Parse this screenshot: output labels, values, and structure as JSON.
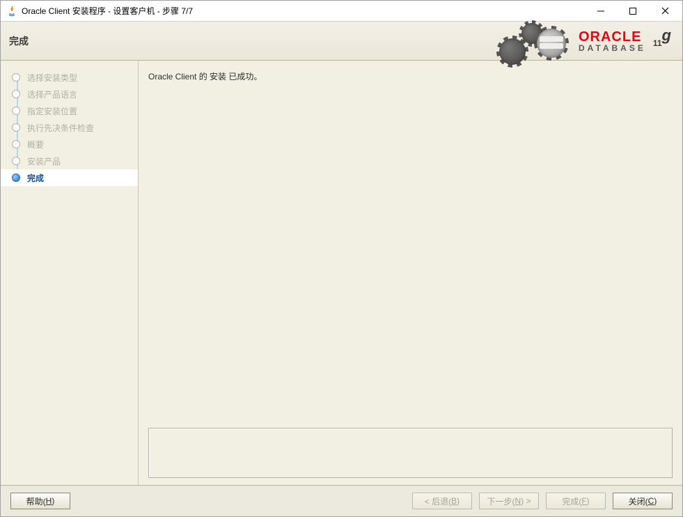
{
  "titlebar": {
    "title": "Oracle Client 安装程序 - 设置客户机 - 步骤 7/7"
  },
  "banner": {
    "page_title": "完成",
    "brand_main": "ORACLE",
    "brand_sub": "DATABASE",
    "version_main": "11",
    "version_suffix": "g"
  },
  "sidebar": {
    "steps": [
      {
        "label": "选择安装类型",
        "active": false
      },
      {
        "label": "选择产品语言",
        "active": false
      },
      {
        "label": "指定安装位置",
        "active": false
      },
      {
        "label": "执行先决条件检查",
        "active": false
      },
      {
        "label": "概要",
        "active": false
      },
      {
        "label": "安装产品",
        "active": false
      },
      {
        "label": "完成",
        "active": true
      }
    ]
  },
  "content": {
    "message": "Oracle Client  的 安装 已成功。"
  },
  "footer": {
    "help": {
      "text": "帮助(",
      "key": "H",
      "suffix": ")"
    },
    "back": {
      "text": "< 后退(",
      "key": "B",
      "suffix": ")"
    },
    "next": {
      "text": "下一步(",
      "key": "N",
      "suffix": ") >"
    },
    "finish": {
      "text": "完成(",
      "key": "F",
      "suffix": ")"
    },
    "close": {
      "text": "关闭(",
      "key": "C",
      "suffix": ")"
    }
  }
}
